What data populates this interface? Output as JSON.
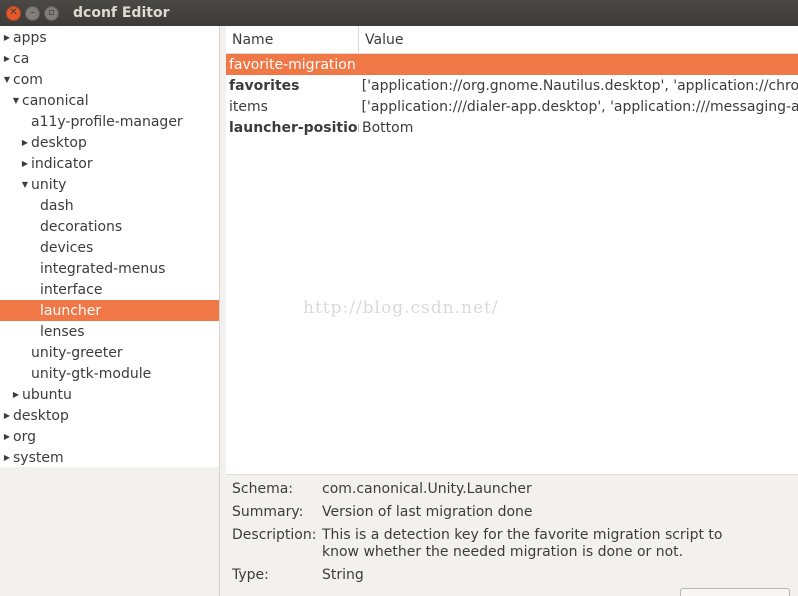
{
  "window": {
    "title": "dconf Editor"
  },
  "tree": {
    "items": [
      {
        "label": "apps",
        "indent": 0,
        "arrow": "right"
      },
      {
        "label": "ca",
        "indent": 0,
        "arrow": "right"
      },
      {
        "label": "com",
        "indent": 0,
        "arrow": "down"
      },
      {
        "label": "canonical",
        "indent": 1,
        "arrow": "down"
      },
      {
        "label": "a11y-profile-manager",
        "indent": 2,
        "arrow": "none"
      },
      {
        "label": "desktop",
        "indent": 2,
        "arrow": "right"
      },
      {
        "label": "indicator",
        "indent": 2,
        "arrow": "right"
      },
      {
        "label": "unity",
        "indent": 2,
        "arrow": "down"
      },
      {
        "label": "dash",
        "indent": 3,
        "arrow": "none"
      },
      {
        "label": "decorations",
        "indent": 3,
        "arrow": "none"
      },
      {
        "label": "devices",
        "indent": 3,
        "arrow": "none"
      },
      {
        "label": "integrated-menus",
        "indent": 3,
        "arrow": "none"
      },
      {
        "label": "interface",
        "indent": 3,
        "arrow": "none"
      },
      {
        "label": "launcher",
        "indent": 3,
        "arrow": "none",
        "selected": true
      },
      {
        "label": "lenses",
        "indent": 3,
        "arrow": "none"
      },
      {
        "label": "unity-greeter",
        "indent": 2,
        "arrow": "none"
      },
      {
        "label": "unity-gtk-module",
        "indent": 2,
        "arrow": "none"
      },
      {
        "label": "ubuntu",
        "indent": 1,
        "arrow": "right"
      },
      {
        "label": "desktop",
        "indent": 0,
        "arrow": "right"
      },
      {
        "label": "org",
        "indent": 0,
        "arrow": "right"
      },
      {
        "label": "system",
        "indent": 0,
        "arrow": "right"
      }
    ]
  },
  "keys": {
    "columns": {
      "name": "Name",
      "value": "Value"
    },
    "rows": [
      {
        "name": "favorite-migration",
        "value": "",
        "bold": false,
        "selected": true
      },
      {
        "name": "favorites",
        "value": "['application://org.gnome.Nautilus.desktop', 'application://chro",
        "bold": true,
        "selected": false
      },
      {
        "name": "items",
        "value": "['application:///dialer-app.desktop', 'application:///messaging-a",
        "bold": false,
        "selected": false
      },
      {
        "name": "launcher-position",
        "value": "Bottom",
        "bold": true,
        "selected": false
      }
    ]
  },
  "info": {
    "schema_label": "Schema:",
    "schema": "com.canonical.Unity.Launcher",
    "summary_label": "Summary:",
    "summary": "Version of last migration done",
    "description_label": "Description:",
    "description": "This is a detection key for the favorite migration script to know whether the needed migration is done or not.",
    "type_label": "Type:",
    "type": "String"
  },
  "watermark": "http://blog.csdn.net/",
  "colors": {
    "selection": "#f07746",
    "titlebar": "#3c3b37",
    "close": "#e3582c"
  }
}
